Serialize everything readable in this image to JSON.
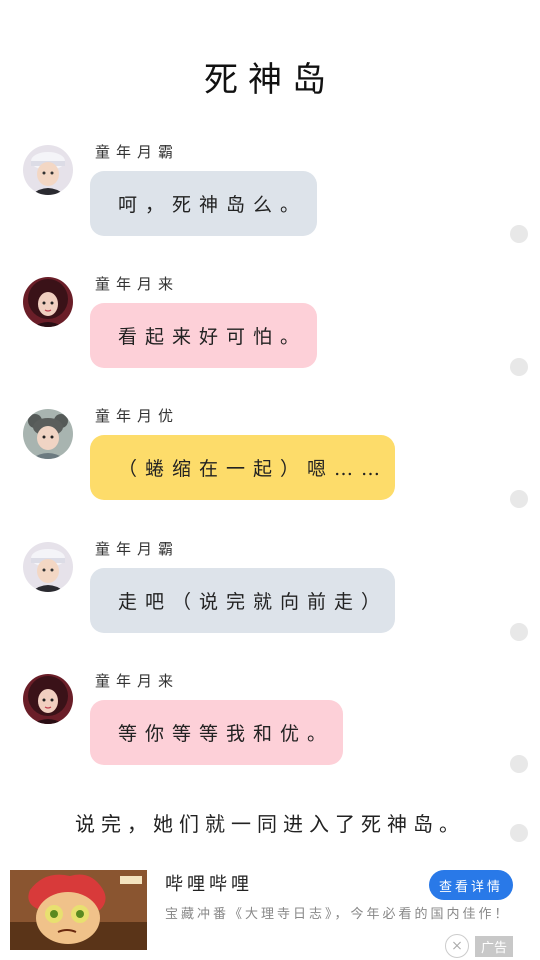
{
  "title": "死神岛",
  "messages": [
    {
      "name": "童年月霸",
      "text": "呵，死神岛么。",
      "color": "#dde3ea"
    },
    {
      "name": "童年月来",
      "text": "看起来好可怕。",
      "color": "#fdd0d8"
    },
    {
      "name": "童年月优",
      "text": "（蜷缩在一起）嗯……",
      "color": "#fddc6a"
    },
    {
      "name": "童年月霸",
      "text": "走吧（说完就向前走）",
      "color": "#dde3ea"
    },
    {
      "name": "童年月来",
      "text": "等你等等我和优。",
      "color": "#fdd0d8"
    }
  ],
  "narration": "说完，她们就一同进入了死神岛。",
  "ad": {
    "title": "哔哩哔哩",
    "button": "查看详情",
    "desc": "宝藏冲番《大理寺日志》，今年必看的国内佳作！",
    "tag": "广告",
    "close": "×"
  }
}
